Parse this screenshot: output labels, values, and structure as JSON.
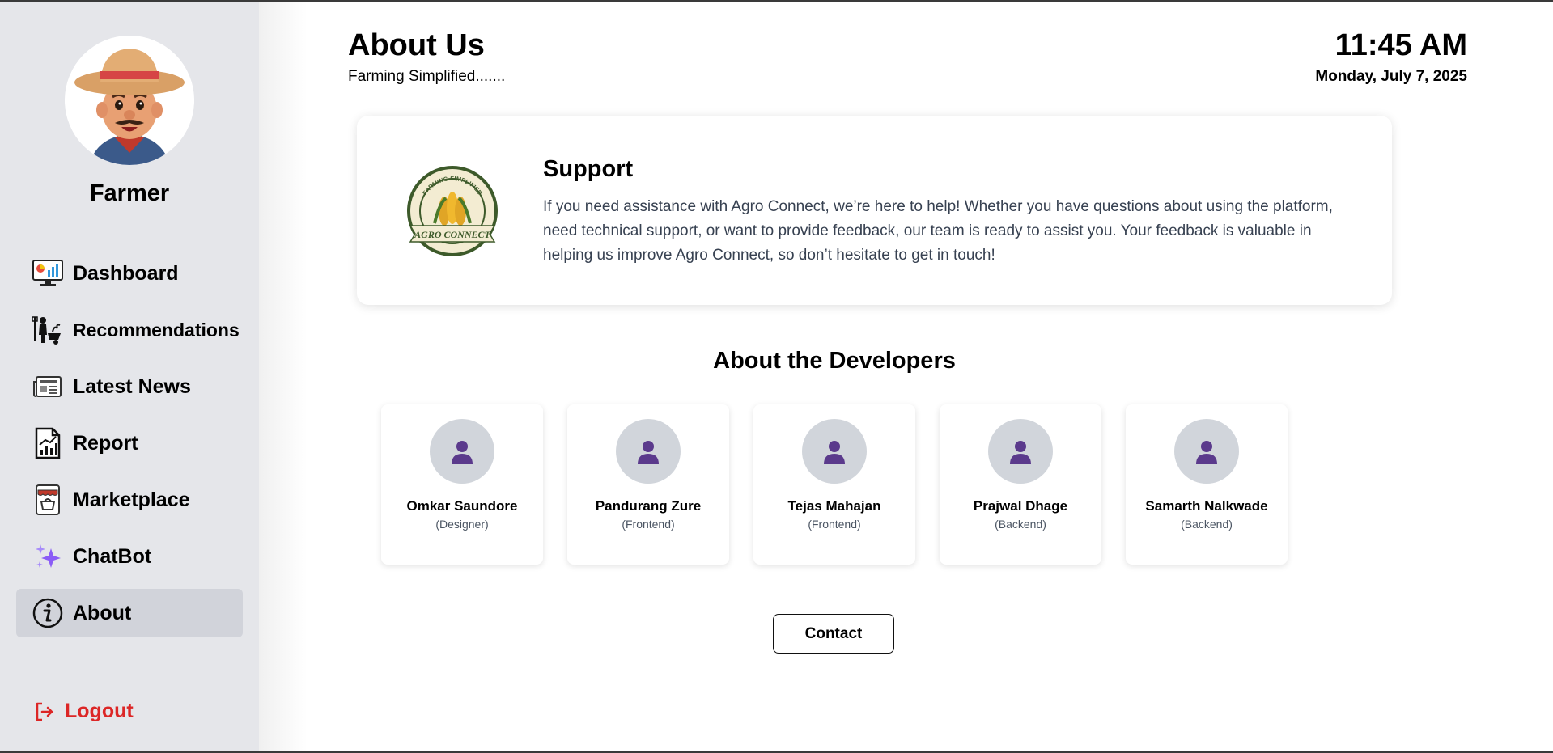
{
  "sidebar": {
    "profile_name": "Farmer",
    "items": [
      {
        "label": "Dashboard",
        "icon": "dashboard-monitor-icon"
      },
      {
        "label": "Recommendations",
        "icon": "farmer-wheelbarrow-icon"
      },
      {
        "label": "Latest News",
        "icon": "newspaper-icon"
      },
      {
        "label": "Report",
        "icon": "report-chart-icon"
      },
      {
        "label": "Marketplace",
        "icon": "marketplace-icon"
      },
      {
        "label": "ChatBot",
        "icon": "sparkles-icon"
      },
      {
        "label": "About",
        "icon": "info-icon",
        "active": true
      }
    ],
    "logout_label": "Logout"
  },
  "header": {
    "title": "About Us",
    "subtitle": "Farming Simplified.......",
    "time": "11:45 AM",
    "date": "Monday, July 7, 2025"
  },
  "support": {
    "heading": "Support",
    "text": "If you need assistance with Agro Connect, we’re here to help! Whether you have questions about using the platform, need technical support, or want to provide feedback, our team is ready to assist you. Your feedback is valuable in helping us improve Agro Connect, so don’t hesitate to get in touch!",
    "logo_text_top": "FARMING SIMPLIFIED",
    "logo_text_bottom": "AGRO CONNECT"
  },
  "developers": {
    "heading": "About the Developers",
    "members": [
      {
        "name": "Omkar Saundore",
        "role": "(Designer)"
      },
      {
        "name": "Pandurang Zure",
        "role": "(Frontend)"
      },
      {
        "name": "Tejas Mahajan",
        "role": "(Frontend)"
      },
      {
        "name": "Prajwal Dhage",
        "role": "(Backend)"
      },
      {
        "name": "Samarth Nalkwade",
        "role": "(Backend)"
      }
    ]
  },
  "contact_label": "Contact",
  "colors": {
    "sidebar_bg": "#e5e6ea",
    "active_item_bg": "#d1d3da",
    "logout": "#dc2626",
    "dev_icon": "#5b3a8c"
  }
}
